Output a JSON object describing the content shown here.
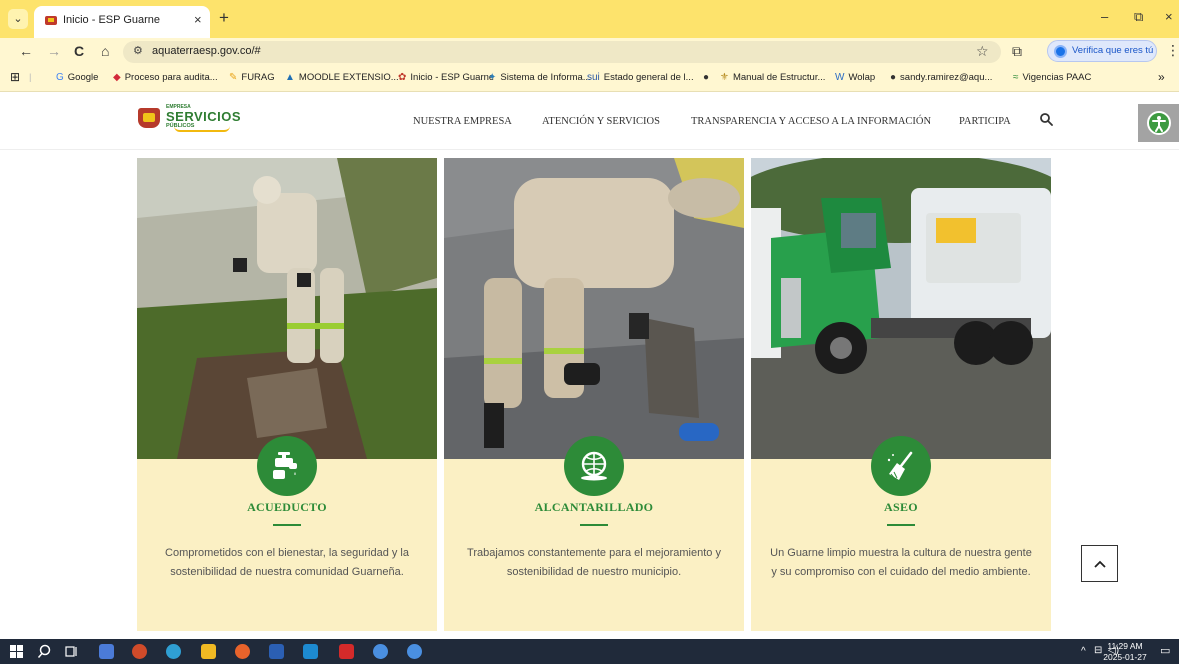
{
  "browser": {
    "tab": {
      "title": "Inicio - ESP Guarne",
      "close": "×"
    },
    "new_tab": "+",
    "window": {
      "minimize": "–",
      "restore": "⧉",
      "close": "×"
    },
    "nav": {
      "back": "←",
      "forward": "→",
      "reload": "C",
      "home": "⌂"
    },
    "url": "aquaterraesp.gov.co/#",
    "star": "☆",
    "extensions": "⧉",
    "verify_label": "Verifica que eres tú",
    "menu": "⋮",
    "bookmarks": [
      {
        "label": "Google",
        "icon": "G",
        "color": "#4285f4"
      },
      {
        "label": "Proceso para audita...",
        "icon": "◆",
        "color": "#d22a3a"
      },
      {
        "label": "FURAG",
        "icon": "✎",
        "color": "#e8a317"
      },
      {
        "label": "MOODLE EXTENSIO...",
        "icon": "▲",
        "color": "#1f6fb4"
      },
      {
        "label": "Inicio - ESP Guarne",
        "icon": "✿",
        "color": "#c0392b"
      },
      {
        "label": "Sistema de Informa...",
        "icon": "✦",
        "color": "#2d7fb8"
      },
      {
        "label": "Estado general de l...",
        "icon": "sui",
        "color": "#2b58a5"
      },
      {
        "label": "",
        "icon": "●",
        "color": "#333333"
      },
      {
        "label": "Manual de Estructur...",
        "icon": "⚜",
        "color": "#b58a1e"
      },
      {
        "label": "Wolap",
        "icon": "W",
        "color": "#2b6cc4"
      },
      {
        "label": "sandy.ramirez@aqu...",
        "icon": "●",
        "color": "#333333"
      },
      {
        "label": "Vigencias PAAC",
        "icon": "≈",
        "color": "#2d8b38"
      }
    ],
    "bookmarks_overflow": "»"
  },
  "site": {
    "logo": {
      "top": "EMPRESA",
      "main": "SERVICIOS",
      "sub": "PÚBLICOS"
    },
    "menu": [
      "NUESTRA EMPRESA",
      "ATENCIÓN Y SERVICIOS",
      "TRANSPARENCIA Y ACCESO A LA INFORMACIÓN",
      "PARTICIPA"
    ],
    "accent": "#2d8b38",
    "card_bg": "#fbf0c4"
  },
  "cards": [
    {
      "title": "ACUEDUCTO",
      "icon": "faucet-icon",
      "desc": "Comprometidos con el bienestar, la seguridad y la sostenibilidad de nuestra comunidad Guarneña."
    },
    {
      "title": "ALCANTARILLADO",
      "icon": "sewer-globe-icon",
      "desc": "Trabajamos constantemente para el mejoramiento y sostenibilidad de nuestro municipio."
    },
    {
      "title": "ASEO",
      "icon": "broom-icon",
      "desc": "Un Guarne limpio muestra la cultura de nuestra gente y su compromiso con el cuidado del medio ambiente."
    }
  ],
  "scroll_top": "^",
  "taskbar": {
    "time": "11:29 AM",
    "date": "2025-01-27"
  }
}
